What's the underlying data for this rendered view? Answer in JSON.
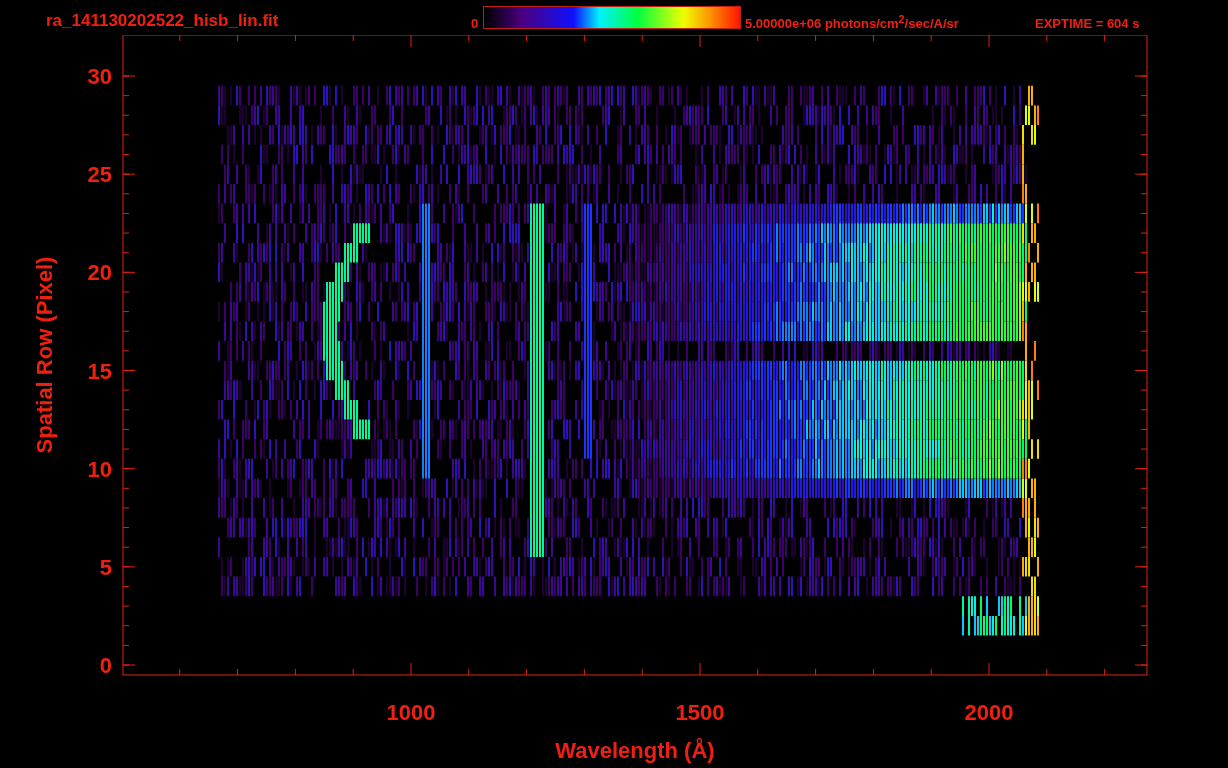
{
  "title": "ra_141130202522_hisb_lin.fit",
  "colorbar": {
    "min_label": "0",
    "max_label": "5.00000e+06 photons/cm$^{2}$/sec/A/sr"
  },
  "exposure": "EXPTIME = 604 s",
  "plot": {
    "xlabel": "Wavelength (Å)",
    "ylabel": "Spatial Row (Pixel)",
    "xticks": [
      "1000",
      "1500",
      "2000"
    ],
    "yticks": [
      "30",
      "25",
      "20",
      "15",
      "10",
      "5",
      "0"
    ]
  }
}
